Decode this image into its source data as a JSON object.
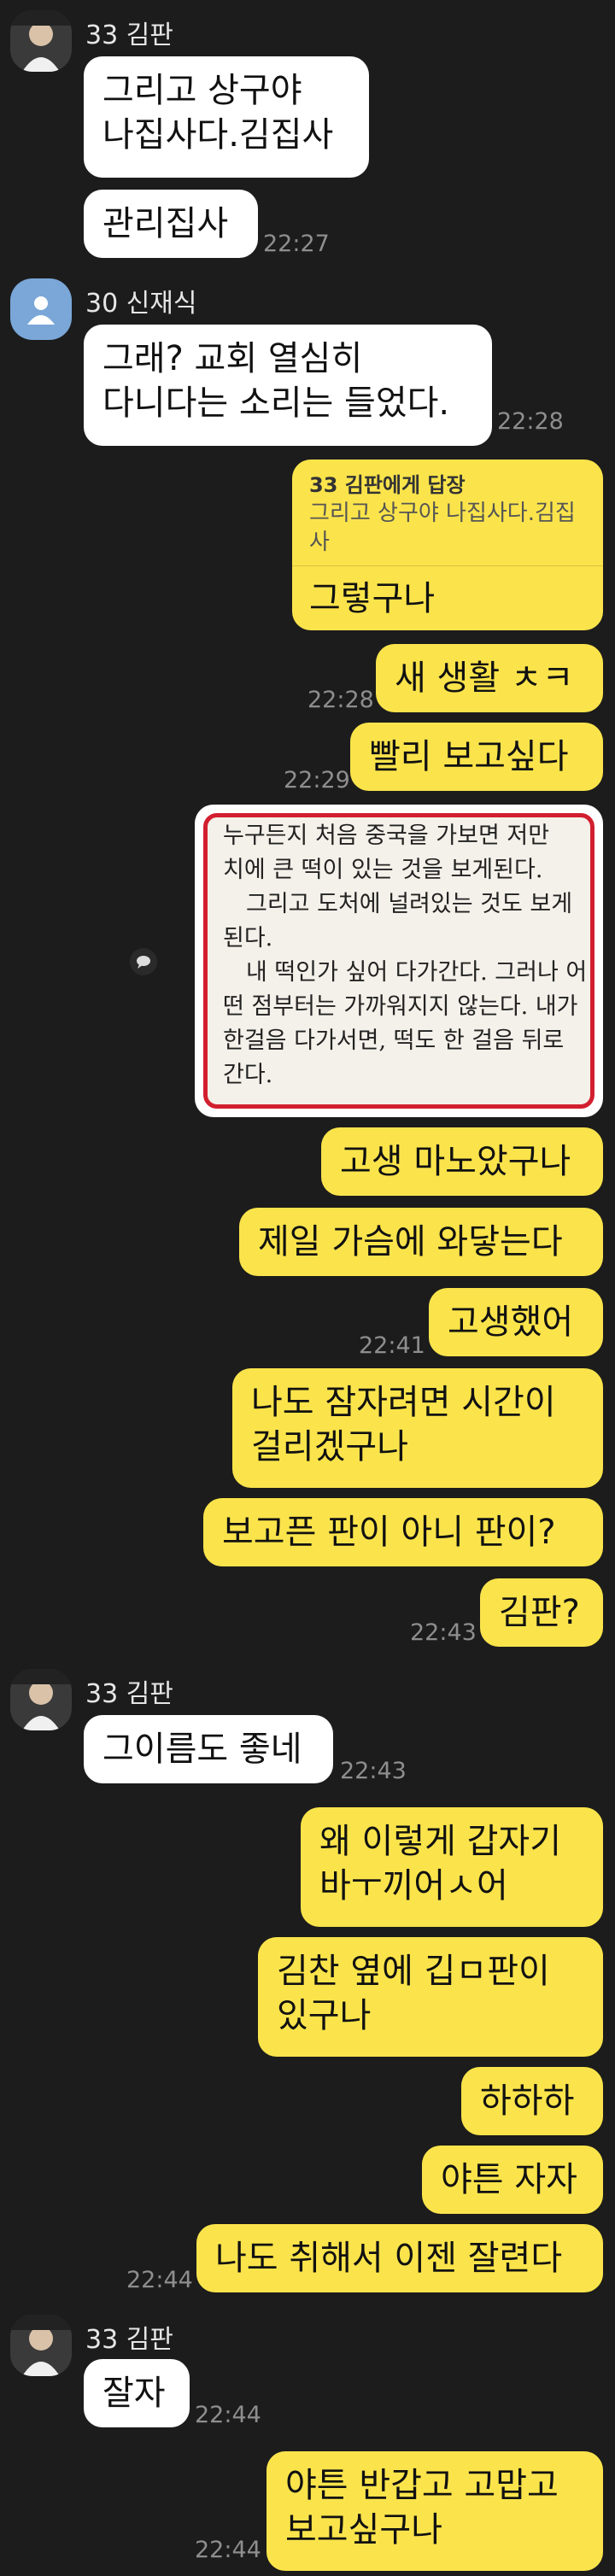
{
  "chat": {
    "messages": [
      {
        "sender": "33 김판",
        "avatar": "person-photo",
        "side": "left",
        "lines": [
          "그리고 상구야",
          "나집사다.김집사"
        ]
      },
      {
        "side": "left",
        "lines": [
          "관리집사"
        ],
        "time": "22:27"
      },
      {
        "sender": "30 신재식",
        "avatar": "default-avatar",
        "side": "left",
        "lines": [
          "그래? 교회 열심히",
          "다니다는 소리는 들었다."
        ],
        "time": "22:28"
      },
      {
        "side": "right",
        "reply": {
          "to": "33 김판에게 답장",
          "quote": "그리고 상구야 나집사다.김집사"
        },
        "lines": [
          "그렇구나"
        ]
      },
      {
        "side": "right",
        "lines": [
          "새 생활 ㅊㅋ"
        ],
        "time": "22:28"
      },
      {
        "side": "right",
        "lines": [
          "빨리 보고싶다"
        ],
        "time": "22:29"
      },
      {
        "side": "right",
        "image": {
          "lines": [
            "누구든지 처음 중국을 가보면 저만",
            "치에 큰 떡이 있는 것을 보게된다.",
            "　그리고 도처에 널려있는 것도 보게",
            "된다.",
            "　내 떡인가 싶어 다가간다. 그러나 어",
            "떤 점부터는 가까워지지 않는다. 내가",
            "한걸음 다가서면, 떡도 한 걸음 뒤로",
            "간다."
          ]
        }
      },
      {
        "side": "right",
        "lines": [
          "고생 마노았구나"
        ]
      },
      {
        "side": "right",
        "lines": [
          "제일 가슴에 와닿는다"
        ]
      },
      {
        "side": "right",
        "lines": [
          "고생했어"
        ],
        "time": "22:41"
      },
      {
        "side": "right",
        "lines": [
          "나도 잠자려면 시간이",
          "걸리겠구나"
        ]
      },
      {
        "side": "right",
        "lines": [
          "보고픈 판이  아니 판이?"
        ]
      },
      {
        "side": "right",
        "lines": [
          "김판?"
        ],
        "time": "22:43"
      },
      {
        "sender": "33 김판",
        "avatar": "person-photo",
        "side": "left",
        "lines": [
          "그이름도 좋네"
        ],
        "time": "22:43"
      },
      {
        "side": "right",
        "lines": [
          "왜 이렇게 갑자기",
          "바ㅜ끼어ㅅ어"
        ]
      },
      {
        "side": "right",
        "lines": [
          "김찬  옆에 깁ㅁ판이",
          "있구나"
        ]
      },
      {
        "side": "right",
        "lines": [
          "하하하"
        ]
      },
      {
        "side": "right",
        "lines": [
          "야튼 자자"
        ]
      },
      {
        "side": "right",
        "lines": [
          "나도 취해서 이젠 잘련다"
        ],
        "time": "22:44"
      },
      {
        "sender": "33 김판",
        "avatar": "person-photo",
        "side": "left",
        "lines": [
          "잘자"
        ],
        "time": "22:44"
      },
      {
        "side": "right",
        "lines": [
          "야튼 반갑고 고맙고",
          "보고싶구나"
        ],
        "time": "22:44"
      }
    ]
  },
  "colors": {
    "background": "#1c1c1c",
    "my_bubble": "#fbe44b",
    "their_bubble": "#ffffff",
    "time": "#8e8e8e"
  }
}
